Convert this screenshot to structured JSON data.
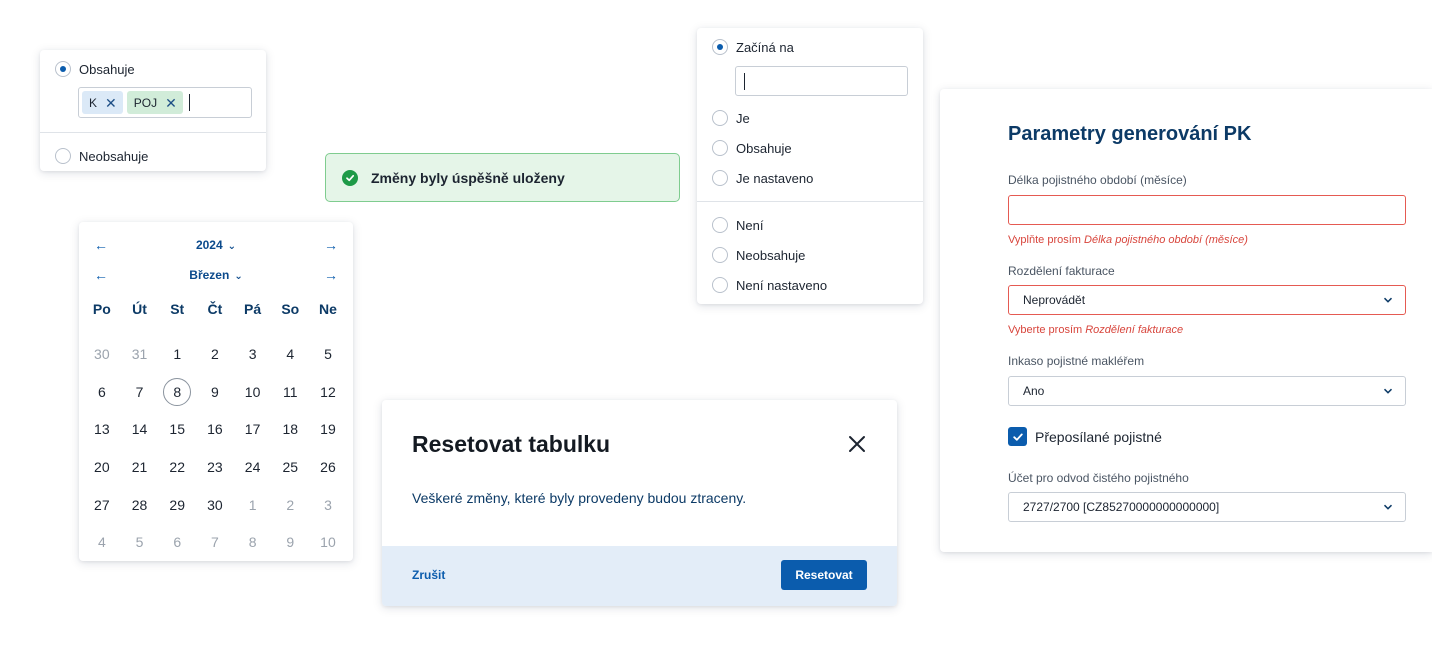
{
  "filter_contains": {
    "option_contains": "Obsahuje",
    "chips": [
      "K",
      "POJ"
    ],
    "option_not_contains": "Neobsahuje"
  },
  "toast": {
    "message": "Změny byly úspěšně uloženy"
  },
  "calendar": {
    "year": "2024",
    "month": "Březen",
    "weekdays": [
      "Po",
      "Út",
      "St",
      "Čt",
      "Pá",
      "So",
      "Ne"
    ],
    "days": [
      {
        "d": "30",
        "muted": true
      },
      {
        "d": "31",
        "muted": true
      },
      {
        "d": "1"
      },
      {
        "d": "2"
      },
      {
        "d": "3"
      },
      {
        "d": "4"
      },
      {
        "d": "5"
      },
      {
        "d": "6"
      },
      {
        "d": "7"
      },
      {
        "d": "8",
        "today": true
      },
      {
        "d": "9"
      },
      {
        "d": "10"
      },
      {
        "d": "11"
      },
      {
        "d": "12"
      },
      {
        "d": "13"
      },
      {
        "d": "14"
      },
      {
        "d": "15"
      },
      {
        "d": "16"
      },
      {
        "d": "17"
      },
      {
        "d": "18"
      },
      {
        "d": "19"
      },
      {
        "d": "20"
      },
      {
        "d": "21"
      },
      {
        "d": "22"
      },
      {
        "d": "23"
      },
      {
        "d": "24"
      },
      {
        "d": "25"
      },
      {
        "d": "26"
      },
      {
        "d": "27"
      },
      {
        "d": "28"
      },
      {
        "d": "29"
      },
      {
        "d": "30"
      },
      {
        "d": "1",
        "muted": true
      },
      {
        "d": "2",
        "muted": true
      },
      {
        "d": "3",
        "muted": true
      },
      {
        "d": "4",
        "muted": true
      },
      {
        "d": "5",
        "muted": true
      },
      {
        "d": "6",
        "muted": true
      },
      {
        "d": "7",
        "muted": true
      },
      {
        "d": "8",
        "muted": true
      },
      {
        "d": "9",
        "muted": true
      },
      {
        "d": "10",
        "muted": true
      }
    ]
  },
  "operator_list": {
    "options_top": [
      "Začíná na",
      "Je",
      "Obsahuje",
      "Je nastaveno"
    ],
    "options_bottom": [
      "Není",
      "Neobsahuje",
      "Není nastaveno"
    ],
    "selected": "Začíná na"
  },
  "dialog": {
    "title": "Resetovat tabulku",
    "body": "Veškeré změny, které byly provedeny budou ztraceny.",
    "cancel_label": "Zrušit",
    "confirm_label": "Resetovat"
  },
  "form": {
    "title": "Parametry generování PK",
    "period_label": "Délka pojistného období (měsíce)",
    "period_value": "",
    "period_error_prefix": "Vyplňte prosím ",
    "period_error_field": "Délka pojistného období (měsíce)",
    "billing_label": "Rozdělení fakturace",
    "billing_value": "Neprovádět",
    "billing_error_prefix": "Vyberte prosím ",
    "billing_error_field": "Rozdělení fakturace",
    "collection_label": "Inkaso pojistné makléřem",
    "collection_value": "Ano",
    "forwarded_label": "Přeposílané pojistné",
    "forwarded_checked": true,
    "account_label": "Účet pro odvod čistého pojistného",
    "account_value": "2727/2700 [CZ85270000000000000]"
  },
  "colors": {
    "primary": "#0b5cad",
    "error": "#d8453c",
    "success": "#1e9a47",
    "heading": "#0c3a66"
  }
}
